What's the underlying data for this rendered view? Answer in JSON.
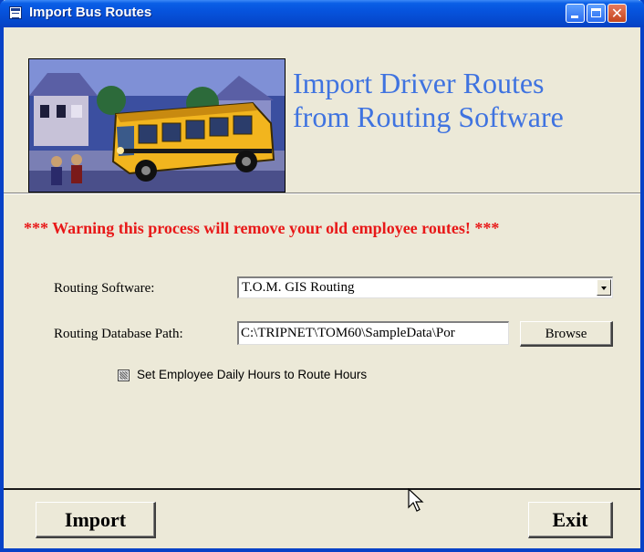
{
  "window": {
    "title": "Import Bus Routes",
    "controls": [
      "minimize",
      "maximize",
      "close"
    ]
  },
  "header": {
    "image_icon": "school-bus-illustration",
    "title_line1": "Import Driver Routes",
    "title_line2": "from Routing Software"
  },
  "warning": "*** Warning this process will remove your old employee routes! ***",
  "form": {
    "software_label": "Routing Software:",
    "software_value": "T.O.M. GIS Routing",
    "path_label": "Routing Database Path:",
    "path_value": "C:\\TRIPNET\\TOM60\\SampleData\\Por",
    "browse_label": "Browse",
    "checkbox_label": "Set Employee Daily Hours to Route Hours",
    "checkbox_checked": true
  },
  "footer": {
    "import_label": "Import",
    "exit_label": "Exit"
  },
  "colors": {
    "title_bar": "#0653dd",
    "window_bg": "#ece9d8",
    "header_title": "#3f73e0",
    "warning": "#e81818"
  }
}
